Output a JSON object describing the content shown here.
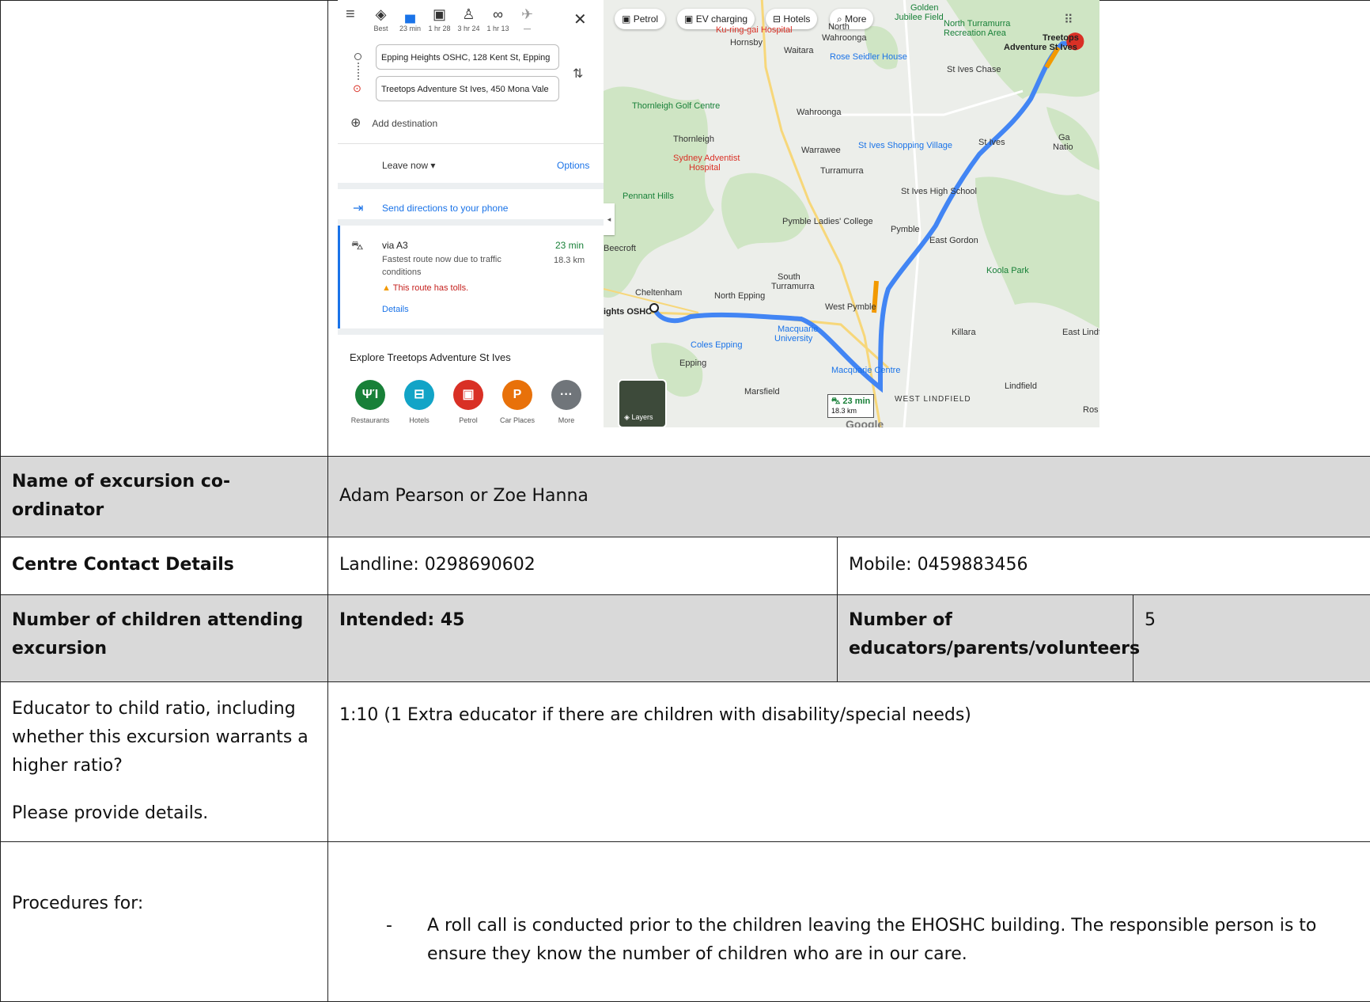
{
  "map_panel": {
    "modes": [
      {
        "icon": "route-best-icon",
        "label": "Best"
      },
      {
        "icon": "car-icon",
        "label": "23 min"
      },
      {
        "icon": "transit-icon",
        "label": "1 hr 28"
      },
      {
        "icon": "walk-icon",
        "label": "3 hr 24"
      },
      {
        "icon": "bike-icon",
        "label": "1 hr 13"
      },
      {
        "icon": "flight-icon",
        "label": "—"
      }
    ],
    "origin": "Epping Heights OSHC, 128 Kent St, Epping",
    "destination": "Treetops Adventure St Ives, 450 Mona Vale",
    "add_destination": "Add destination",
    "leave_now": "Leave now",
    "options": "Options",
    "send_directions": "Send directions to your phone",
    "route": {
      "via": "via A3",
      "time": "23 min",
      "distance": "18.3 km",
      "desc": "Fastest route now due to traffic conditions",
      "warning": "This route has tolls.",
      "details": "Details"
    },
    "explore_title": "Explore Treetops Adventure St Ives",
    "explore_items": [
      {
        "label": "Restaurants",
        "glyph": "ΨΊ",
        "color": "#188038"
      },
      {
        "label": "Hotels",
        "glyph": "⊟",
        "color": "#12a4c7"
      },
      {
        "label": "Petrol",
        "glyph": "▣",
        "color": "#d93025"
      },
      {
        "label": "Car Places",
        "glyph": "P",
        "color": "#e8710a"
      },
      {
        "label": "More",
        "glyph": "···",
        "color": "#70757a"
      }
    ]
  },
  "map": {
    "chips": [
      "Petrol",
      "EV charging",
      "Hotels",
      "More"
    ],
    "labels": {
      "golden": "Golden",
      "jubilee": "Jubilee Field",
      "north_turramurra": "North Turramurra",
      "recreation_area": "Recreation Area",
      "north": "North",
      "wahroonga_n": "Wahroonga",
      "ku_ring_gai": "Ku-ring-gai Hospital",
      "treetops": "Treetops",
      "treetops2": "Adventure St Ives",
      "hornsby": "Hornsby",
      "waitara": "Waitara",
      "rose_seidler": "Rose Seidler House",
      "st_ives_chase": "St Ives Chase",
      "thornleigh_golf": "Thornleigh Golf Centre",
      "wahroonga": "Wahroonga",
      "thornleigh": "Thornleigh",
      "sydney_adventist": "Sydney Adventist",
      "hospital": "Hospital",
      "warrawee": "Warrawee",
      "st_ives_shopping": "St Ives Shopping Village",
      "st_ives": "St Ives",
      "turramurra": "Turramurra",
      "pennant_hills": "Pennant Hills",
      "st_ives_high": "St Ives High School",
      "pymble_ladies": "Pymble Ladies' College",
      "pymble": "Pymble",
      "beecroft": "Beecroft",
      "east_gordon": "East Gordon",
      "south": "South",
      "turramurra2": "Turramurra",
      "koola_park": "Koola Park",
      "cheltenham": "Cheltenham",
      "north_epping": "North Epping",
      "west_pymble": "West Pymble",
      "heights_oshc": "ights OSHC",
      "macquarie_uni": "Macquarie",
      "university": "University",
      "killara": "Killara",
      "east_lindf": "East Lindf",
      "coles_epping": "Coles Epping",
      "epping": "Epping",
      "macquarie_centre": "Macquarie Centre",
      "marsfield": "Marsfield",
      "lindfield": "Lindfield",
      "west_lindfield": "WEST LINDFIELD",
      "ros": "Ros",
      "gar": "Ga",
      "nation": "Natio"
    },
    "layers": "Layers",
    "eta_time": "23 min",
    "eta_dist": "18.3 km",
    "google": "Google"
  },
  "rows": {
    "coordinator_label": "Name of excursion co-ordinator",
    "coordinator_value": "Adam Pearson or Zoe Hanna",
    "contact_label": "Centre Contact Details",
    "landline": "Landline: 0298690602",
    "mobile": "Mobile: 0459883456",
    "children_label": "Number of children attending excursion",
    "intended": "Intended: 45",
    "educators_label": "Number of educators/parents/volunteers",
    "educators_value": "5",
    "ratio_label": "Educator to child ratio, including whether this excursion warrants a higher ratio?",
    "ratio_label2": "Please provide details.",
    "ratio_value": "1:10 (1 Extra educator if there are children with disability/special needs)",
    "procedures_label": "Procedures for:",
    "procedure_dash": "-",
    "procedure_1": "A roll call is conducted prior to the children leaving the EHOSHC building. The responsible person is to ensure they know the number of children who are in our care."
  },
  "colors": {
    "header_grey": "#d9d9d9",
    "route_blue": "#4285f4",
    "link_blue": "#1a73e8"
  }
}
